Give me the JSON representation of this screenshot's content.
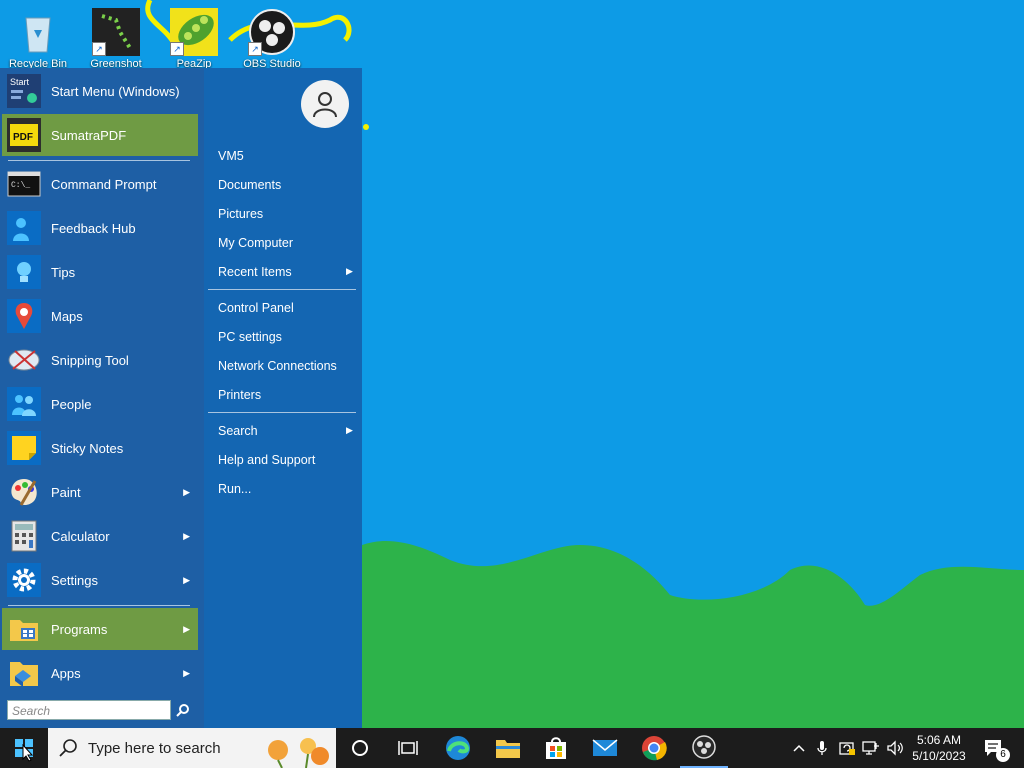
{
  "desktop": {
    "icons": [
      {
        "label": "Recycle Bin"
      },
      {
        "label": "Greenshot"
      },
      {
        "label": "PeaZip"
      },
      {
        "label": "OBS Studio"
      }
    ]
  },
  "start_menu": {
    "left_items": [
      {
        "label": "Start Menu (Windows)",
        "icon": "start-menu-icon"
      },
      {
        "label": "SumatraPDF",
        "icon": "pdf-icon",
        "highlighted": true
      },
      {
        "label": "Command Prompt",
        "icon": "command-prompt-icon"
      },
      {
        "label": "Feedback Hub",
        "icon": "feedback-hub-icon"
      },
      {
        "label": "Tips",
        "icon": "lightbulb-icon"
      },
      {
        "label": "Maps",
        "icon": "map-pin-icon"
      },
      {
        "label": "Snipping Tool",
        "icon": "scissors-icon"
      },
      {
        "label": "People",
        "icon": "people-icon"
      },
      {
        "label": "Sticky Notes",
        "icon": "sticky-note-icon"
      },
      {
        "label": "Paint",
        "icon": "palette-icon",
        "arrow": true
      },
      {
        "label": "Calculator",
        "icon": "calculator-icon",
        "arrow": true
      },
      {
        "label": "Settings",
        "icon": "gear-icon",
        "arrow": true
      },
      {
        "label": "Programs",
        "icon": "programs-folder-icon",
        "arrow": true,
        "highlighted": true
      },
      {
        "label": "Apps",
        "icon": "apps-folder-icon",
        "arrow": true
      }
    ],
    "search_placeholder": "Search",
    "right_items": [
      {
        "label": "VM5"
      },
      {
        "label": "Documents"
      },
      {
        "label": "Pictures"
      },
      {
        "label": "My Computer"
      },
      {
        "label": "Recent Items",
        "arrow": true
      },
      {
        "label": "Control Panel"
      },
      {
        "label": "PC settings"
      },
      {
        "label": "Network Connections"
      },
      {
        "label": "Printers"
      },
      {
        "label": "Search",
        "arrow": true
      },
      {
        "label": "Help and Support"
      },
      {
        "label": "Run..."
      }
    ]
  },
  "taskbar": {
    "search_placeholder": "Type here to search",
    "pinned": [
      "cortana-icon",
      "task-view-icon",
      "edge-icon",
      "file-explorer-icon",
      "store-icon",
      "mail-icon",
      "chrome-icon",
      "obs-icon"
    ],
    "clock_time": "5:06 AM",
    "clock_date": "5/10/2023",
    "notification_count": "6"
  },
  "colors": {
    "sky": "#0d9be6",
    "hills": "#2db34a",
    "menu_blue": "#1e5fa5",
    "highlight_green": "#6f9b44",
    "taskbar": "#1c1c1c"
  }
}
